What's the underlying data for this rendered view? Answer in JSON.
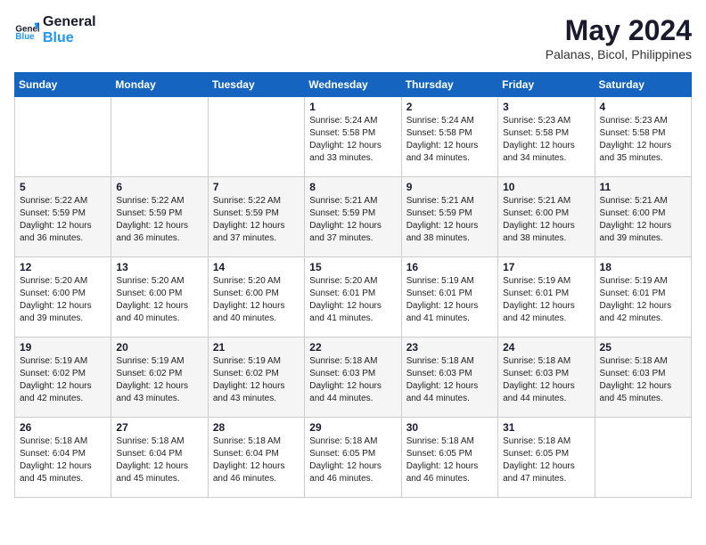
{
  "header": {
    "logo_line1": "General",
    "logo_line2": "Blue",
    "month": "May 2024",
    "location": "Palanas, Bicol, Philippines"
  },
  "days_of_week": [
    "Sunday",
    "Monday",
    "Tuesday",
    "Wednesday",
    "Thursday",
    "Friday",
    "Saturday"
  ],
  "weeks": [
    [
      {
        "day": "",
        "info": ""
      },
      {
        "day": "",
        "info": ""
      },
      {
        "day": "",
        "info": ""
      },
      {
        "day": "1",
        "info": "Sunrise: 5:24 AM\nSunset: 5:58 PM\nDaylight: 12 hours\nand 33 minutes."
      },
      {
        "day": "2",
        "info": "Sunrise: 5:24 AM\nSunset: 5:58 PM\nDaylight: 12 hours\nand 34 minutes."
      },
      {
        "day": "3",
        "info": "Sunrise: 5:23 AM\nSunset: 5:58 PM\nDaylight: 12 hours\nand 34 minutes."
      },
      {
        "day": "4",
        "info": "Sunrise: 5:23 AM\nSunset: 5:58 PM\nDaylight: 12 hours\nand 35 minutes."
      }
    ],
    [
      {
        "day": "5",
        "info": "Sunrise: 5:22 AM\nSunset: 5:59 PM\nDaylight: 12 hours\nand 36 minutes."
      },
      {
        "day": "6",
        "info": "Sunrise: 5:22 AM\nSunset: 5:59 PM\nDaylight: 12 hours\nand 36 minutes."
      },
      {
        "day": "7",
        "info": "Sunrise: 5:22 AM\nSunset: 5:59 PM\nDaylight: 12 hours\nand 37 minutes."
      },
      {
        "day": "8",
        "info": "Sunrise: 5:21 AM\nSunset: 5:59 PM\nDaylight: 12 hours\nand 37 minutes."
      },
      {
        "day": "9",
        "info": "Sunrise: 5:21 AM\nSunset: 5:59 PM\nDaylight: 12 hours\nand 38 minutes."
      },
      {
        "day": "10",
        "info": "Sunrise: 5:21 AM\nSunset: 6:00 PM\nDaylight: 12 hours\nand 38 minutes."
      },
      {
        "day": "11",
        "info": "Sunrise: 5:21 AM\nSunset: 6:00 PM\nDaylight: 12 hours\nand 39 minutes."
      }
    ],
    [
      {
        "day": "12",
        "info": "Sunrise: 5:20 AM\nSunset: 6:00 PM\nDaylight: 12 hours\nand 39 minutes."
      },
      {
        "day": "13",
        "info": "Sunrise: 5:20 AM\nSunset: 6:00 PM\nDaylight: 12 hours\nand 40 minutes."
      },
      {
        "day": "14",
        "info": "Sunrise: 5:20 AM\nSunset: 6:00 PM\nDaylight: 12 hours\nand 40 minutes."
      },
      {
        "day": "15",
        "info": "Sunrise: 5:20 AM\nSunset: 6:01 PM\nDaylight: 12 hours\nand 41 minutes."
      },
      {
        "day": "16",
        "info": "Sunrise: 5:19 AM\nSunset: 6:01 PM\nDaylight: 12 hours\nand 41 minutes."
      },
      {
        "day": "17",
        "info": "Sunrise: 5:19 AM\nSunset: 6:01 PM\nDaylight: 12 hours\nand 42 minutes."
      },
      {
        "day": "18",
        "info": "Sunrise: 5:19 AM\nSunset: 6:01 PM\nDaylight: 12 hours\nand 42 minutes."
      }
    ],
    [
      {
        "day": "19",
        "info": "Sunrise: 5:19 AM\nSunset: 6:02 PM\nDaylight: 12 hours\nand 42 minutes."
      },
      {
        "day": "20",
        "info": "Sunrise: 5:19 AM\nSunset: 6:02 PM\nDaylight: 12 hours\nand 43 minutes."
      },
      {
        "day": "21",
        "info": "Sunrise: 5:19 AM\nSunset: 6:02 PM\nDaylight: 12 hours\nand 43 minutes."
      },
      {
        "day": "22",
        "info": "Sunrise: 5:18 AM\nSunset: 6:03 PM\nDaylight: 12 hours\nand 44 minutes."
      },
      {
        "day": "23",
        "info": "Sunrise: 5:18 AM\nSunset: 6:03 PM\nDaylight: 12 hours\nand 44 minutes."
      },
      {
        "day": "24",
        "info": "Sunrise: 5:18 AM\nSunset: 6:03 PM\nDaylight: 12 hours\nand 44 minutes."
      },
      {
        "day": "25",
        "info": "Sunrise: 5:18 AM\nSunset: 6:03 PM\nDaylight: 12 hours\nand 45 minutes."
      }
    ],
    [
      {
        "day": "26",
        "info": "Sunrise: 5:18 AM\nSunset: 6:04 PM\nDaylight: 12 hours\nand 45 minutes."
      },
      {
        "day": "27",
        "info": "Sunrise: 5:18 AM\nSunset: 6:04 PM\nDaylight: 12 hours\nand 45 minutes."
      },
      {
        "day": "28",
        "info": "Sunrise: 5:18 AM\nSunset: 6:04 PM\nDaylight: 12 hours\nand 46 minutes."
      },
      {
        "day": "29",
        "info": "Sunrise: 5:18 AM\nSunset: 6:05 PM\nDaylight: 12 hours\nand 46 minutes."
      },
      {
        "day": "30",
        "info": "Sunrise: 5:18 AM\nSunset: 6:05 PM\nDaylight: 12 hours\nand 46 minutes."
      },
      {
        "day": "31",
        "info": "Sunrise: 5:18 AM\nSunset: 6:05 PM\nDaylight: 12 hours\nand 47 minutes."
      },
      {
        "day": "",
        "info": ""
      }
    ]
  ]
}
